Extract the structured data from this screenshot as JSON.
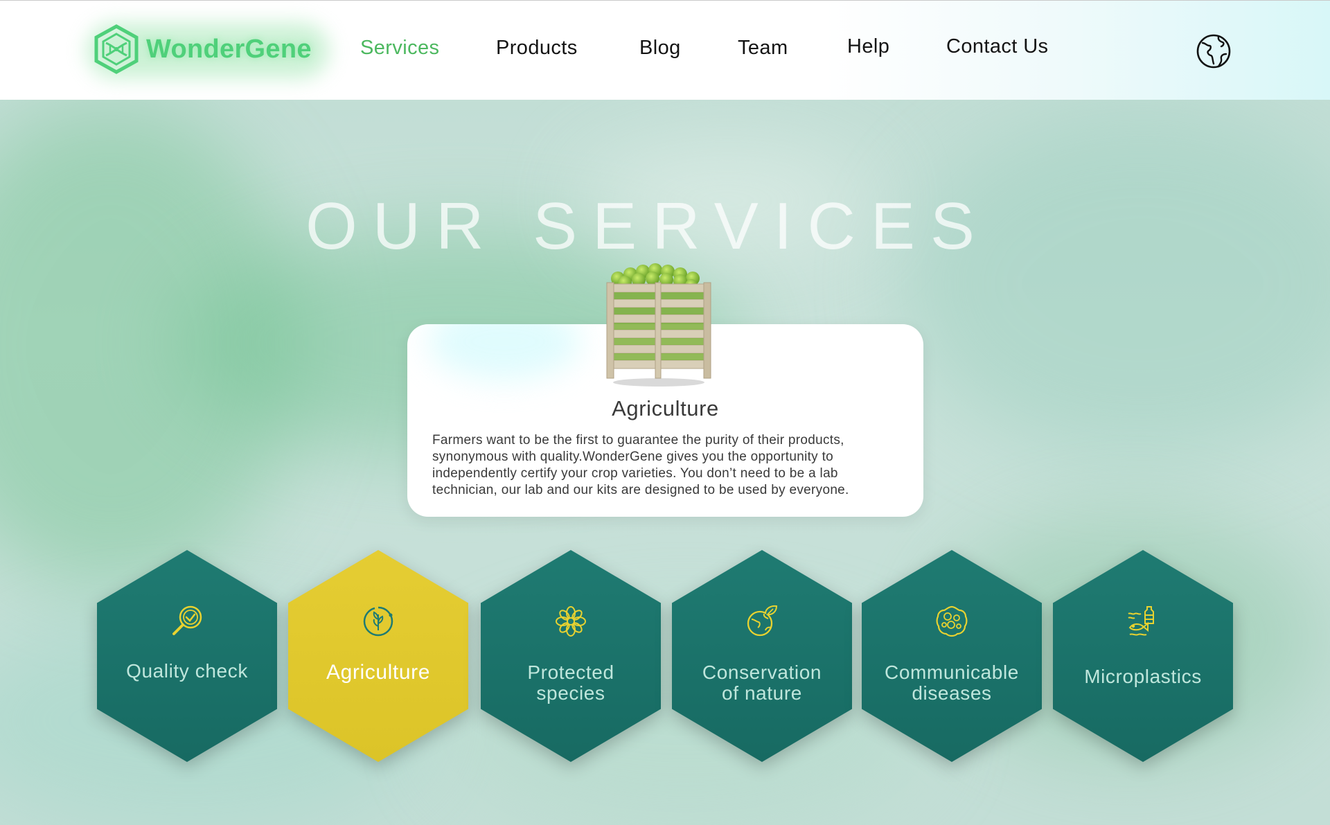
{
  "brand": {
    "name": "WonderGene",
    "logo_icon": "dna-cube-icon",
    "color": "#4fd07a"
  },
  "nav": {
    "items": [
      {
        "label": "Services",
        "active": true
      },
      {
        "label": "Products",
        "active": false
      },
      {
        "label": "Blog",
        "active": false
      },
      {
        "label": "Team",
        "active": false
      },
      {
        "label": "Help",
        "active": false
      },
      {
        "label": "Contact Us",
        "active": false
      }
    ],
    "language_icon": "globe-icon",
    "active_color": "#4cb85f"
  },
  "page": {
    "title": "OUR SERVICES"
  },
  "detail": {
    "image": "apple-crate-image",
    "title": "Agriculture",
    "text": "Farmers want to be the first to guarantee the purity of their products, synonymous with quality.WonderGene gives you the opportunity to independently certify your crop varieties. You don’t need to be a lab technician, our lab and our kits are designed to be used by everyone."
  },
  "services": [
    {
      "label_lines": [
        "Quality check"
      ],
      "icon": "magnifier-check-icon",
      "active": false
    },
    {
      "label_lines": [
        "Agriculture"
      ],
      "icon": "plant-cycle-icon",
      "active": true
    },
    {
      "label_lines": [
        "Protected",
        "species"
      ],
      "icon": "flower-icon",
      "active": false
    },
    {
      "label_lines": [
        "Conservation",
        "of nature"
      ],
      "icon": "earth-leaf-icon",
      "active": false
    },
    {
      "label_lines": [
        "Communicable",
        "diseases"
      ],
      "icon": "virus-icon",
      "active": false
    },
    {
      "label_lines": [
        "Microplastics"
      ],
      "icon": "fish-bottle-icon",
      "active": false
    }
  ],
  "colors": {
    "hex_default": "#1f7b72",
    "hex_active": "#e5cd33",
    "icon_stroke": "#e8d230"
  }
}
